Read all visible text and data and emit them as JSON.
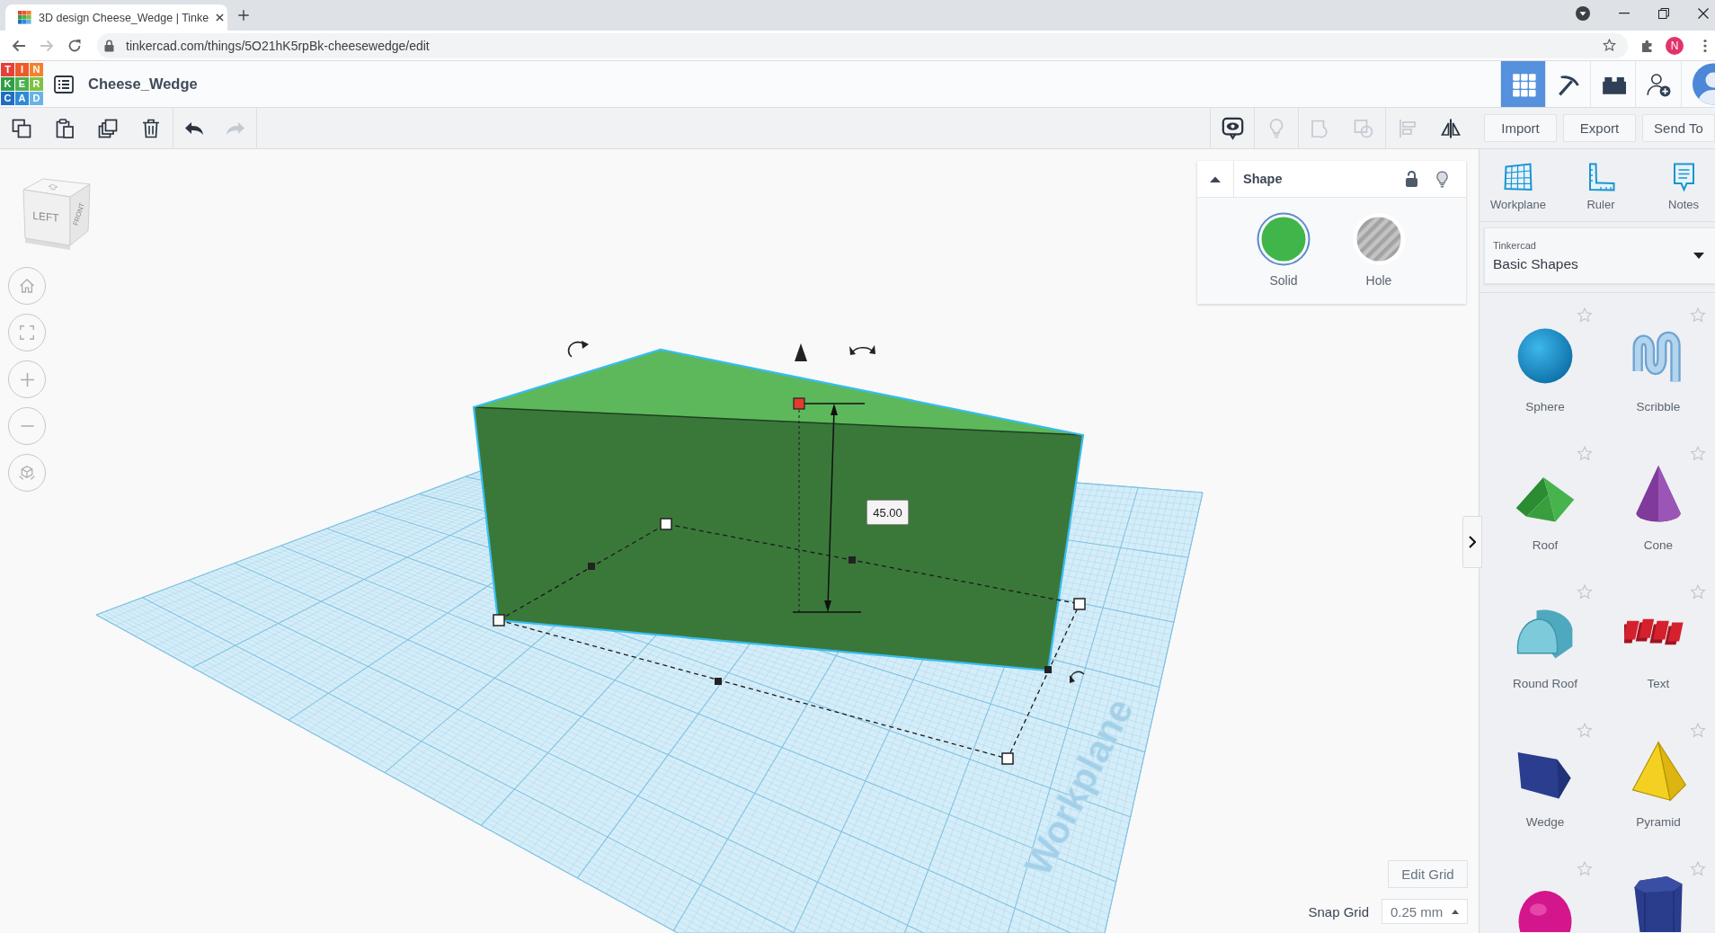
{
  "browser": {
    "tab_title": "3D design Cheese_Wedge | Tinke",
    "nav": [
      {
        "kind": "back",
        "disabled": false
      },
      {
        "kind": "forward",
        "disabled": true
      },
      {
        "kind": "reload",
        "disabled": false
      }
    ],
    "url": "tinkercad.com/things/5O21hK5rpBk-cheesewedge/edit",
    "profile_initial": "N"
  },
  "header": {
    "logo": [
      {
        "letter": "T",
        "color": "#e4403a"
      },
      {
        "letter": "I",
        "color": "#ee5a2c"
      },
      {
        "letter": "N",
        "color": "#f3812c"
      },
      {
        "letter": "K",
        "color": "#2f9e46"
      },
      {
        "letter": "E",
        "color": "#4cb050"
      },
      {
        "letter": "R",
        "color": "#7fc243"
      },
      {
        "letter": "C",
        "color": "#1e6fc2"
      },
      {
        "letter": "A",
        "color": "#2f8ad6"
      },
      {
        "letter": "D",
        "color": "#69b3e7"
      }
    ],
    "design_title": "Cheese_Wedge",
    "view_modes": [
      {
        "kind": "grid",
        "selected": true
      },
      {
        "kind": "pickaxe",
        "selected": false
      },
      {
        "kind": "bricks",
        "selected": false
      }
    ]
  },
  "toolbar": {
    "edit_tools": [
      {
        "kind": "copy",
        "disabled": false
      },
      {
        "kind": "paste",
        "disabled": false
      },
      {
        "kind": "duplicate",
        "disabled": false
      },
      {
        "kind": "delete",
        "disabled": false
      }
    ],
    "history_tools": [
      {
        "kind": "undo",
        "disabled": false
      },
      {
        "kind": "redo",
        "disabled": true
      }
    ],
    "shape_tools": [
      [
        {
          "kind": "notes",
          "disabled": false
        }
      ],
      [
        {
          "kind": "bulb",
          "disabled": true
        }
      ],
      [
        {
          "kind": "group",
          "disabled": true
        },
        {
          "kind": "ungroup",
          "disabled": true
        }
      ],
      [
        {
          "kind": "align",
          "disabled": true
        },
        {
          "kind": "mirror",
          "disabled": false
        }
      ]
    ],
    "actions": [
      "Import",
      "Export",
      "Send To"
    ]
  },
  "canvas": {
    "view_cube": {
      "left_face": "LEFT",
      "front_face": "FRONT"
    },
    "view_controls": [
      {
        "kind": "home"
      },
      {
        "kind": "fit"
      },
      {
        "kind": "zoom-in"
      },
      {
        "kind": "zoom-out"
      },
      {
        "kind": "perspective"
      }
    ],
    "workplane_label": "Workplane",
    "dimension": "45.00",
    "shape_panel": {
      "title": "Shape",
      "expanded": true,
      "locked": false,
      "modes": [
        {
          "kind": "solid",
          "label": "Solid",
          "selected": true
        },
        {
          "kind": "hole",
          "label": "Hole",
          "selected": false
        }
      ]
    },
    "edit_grid": "Edit Grid",
    "snap_grid": {
      "label": "Snap Grid",
      "value": "0.25 mm"
    }
  },
  "sidebar": {
    "tools": [
      {
        "kind": "workplane",
        "label": "Workplane"
      },
      {
        "kind": "ruler",
        "label": "Ruler"
      },
      {
        "kind": "notes",
        "label": "Notes"
      }
    ],
    "library": {
      "source": "Tinkercad",
      "value": "Basic Shapes"
    },
    "shapes": [
      {
        "kind": "sphere",
        "label": "Sphere",
        "favorite": false
      },
      {
        "kind": "scribble",
        "label": "Scribble",
        "favorite": false
      },
      {
        "kind": "roof",
        "label": "Roof",
        "favorite": false
      },
      {
        "kind": "cone",
        "label": "Cone",
        "favorite": false
      },
      {
        "kind": "round-roof",
        "label": "Round Roof",
        "favorite": false
      },
      {
        "kind": "text",
        "label": "Text",
        "favorite": false
      },
      {
        "kind": "wedge",
        "label": "Wedge",
        "favorite": false
      },
      {
        "kind": "pyramid",
        "label": "Pyramid",
        "favorite": false
      },
      {
        "kind": "half-sphere",
        "favorite": false
      },
      {
        "kind": "polygon",
        "favorite": false
      }
    ]
  }
}
